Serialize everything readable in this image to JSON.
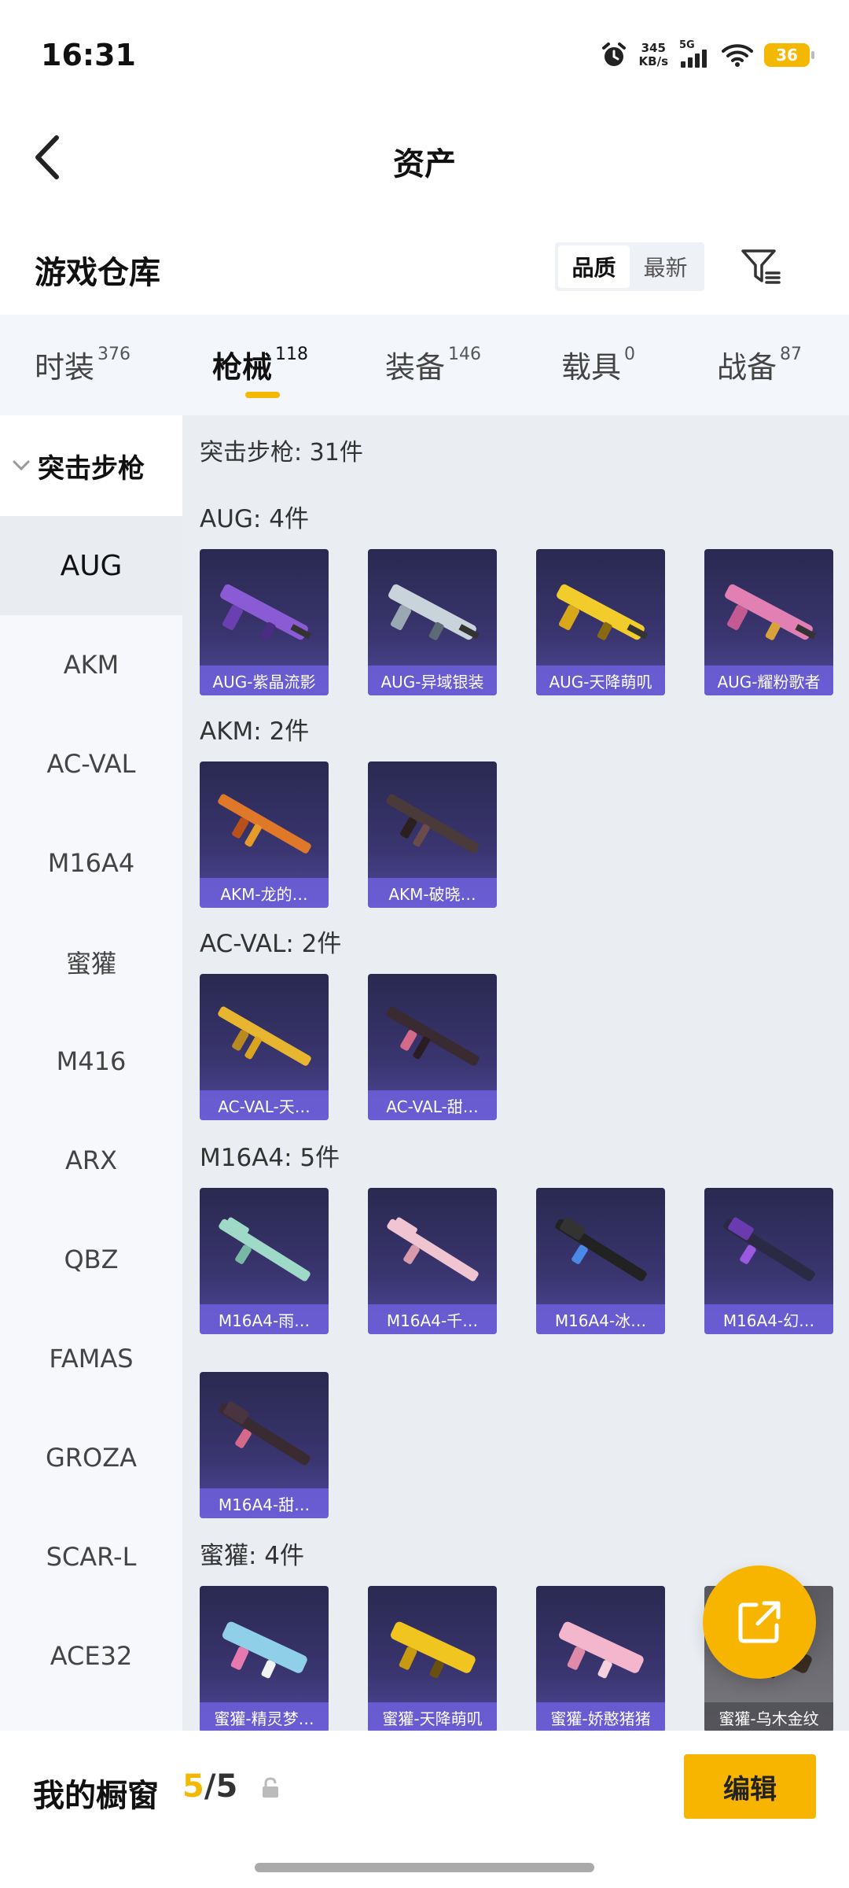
{
  "status": {
    "time": "16:31",
    "net_speed_value": "345",
    "net_speed_unit": "KB/s",
    "network": "5G",
    "battery": "36"
  },
  "header": {
    "title": "资产"
  },
  "warehouse": {
    "title": "游戏仓库",
    "sort_options": [
      "品质",
      "最新"
    ],
    "active_sort": "品质"
  },
  "tabs": [
    {
      "label": "时装",
      "count": "376"
    },
    {
      "label": "枪械",
      "count": "118"
    },
    {
      "label": "装备",
      "count": "146"
    },
    {
      "label": "载具",
      "count": "0"
    },
    {
      "label": "战备",
      "count": "87"
    }
  ],
  "active_tab": "枪械",
  "sidebar": {
    "group": "突击步枪",
    "items": [
      "AUG",
      "AKM",
      "AC-VAL",
      "M16A4",
      "蜜獾",
      "M416",
      "ARX",
      "QBZ",
      "FAMAS",
      "GROZA",
      "SCAR-L",
      "ACE32"
    ],
    "active": "AUG"
  },
  "main": {
    "summary": "突击步枪: 31件",
    "sections": [
      {
        "label": "AUG: 4件",
        "items": [
          "AUG-紫晶流影",
          "AUG-异域银装",
          "AUG-天降萌叽",
          "AUG-耀粉歌者"
        ]
      },
      {
        "label": "AKM: 2件",
        "items": [
          "AKM-龙的…",
          "AKM-破晓…"
        ]
      },
      {
        "label": "AC-VAL: 2件",
        "items": [
          "AC-VAL-天…",
          "AC-VAL-甜…"
        ]
      },
      {
        "label": "M16A4: 5件",
        "items": [
          "M16A4-雨…",
          "M16A4-千…",
          "M16A4-冰…",
          "M16A4-幻…",
          "M16A4-甜…"
        ]
      },
      {
        "label": "蜜獾: 4件",
        "items": [
          "蜜獾-精灵梦…",
          "蜜獾-天降萌叽",
          "蜜獾-娇憨猪猪",
          "蜜獾-乌木金纹"
        ]
      }
    ]
  },
  "bottom": {
    "showcase_label": "我的橱窗",
    "current": "5",
    "separator": "/",
    "max": "5",
    "edit_label": "编辑"
  },
  "colors": {
    "accent": "#F5B800",
    "card_top": "#2A2950",
    "card_bottom": "#514A9C",
    "caption": "#6E5FDC"
  }
}
